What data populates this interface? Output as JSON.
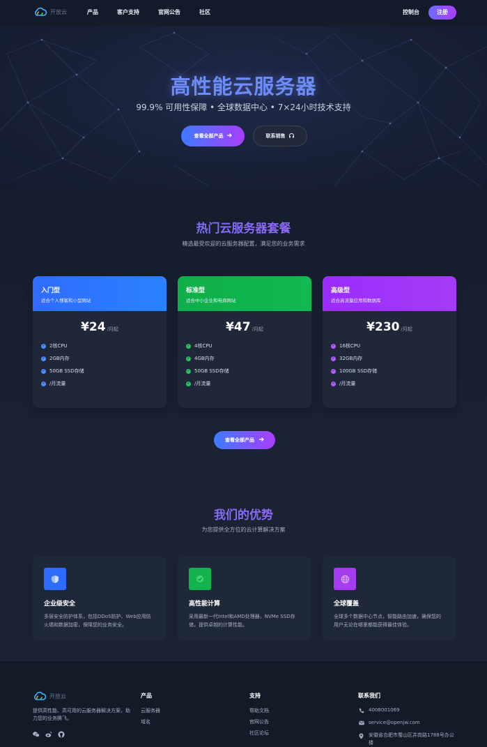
{
  "nav": {
    "logo_text": "开放云",
    "links": [
      "产品",
      "客户支持",
      "官网公告",
      "社区"
    ],
    "console": "控制台",
    "register": "注册"
  },
  "hero": {
    "title": "高性能云服务器",
    "subtitle": "99.9% 可用性保障 • 全球数据中心 • 7×24小时技术支持",
    "primary_button": "查看全部产品",
    "secondary_button": "联系销售"
  },
  "plans_section": {
    "title": "热门云服务器套餐",
    "subtitle": "精选最受欢迎的云服务器配置，满足您的业务需求",
    "plans": [
      {
        "name": "入门型",
        "desc": "适合个人博客和小型网站",
        "price": "¥24",
        "unit": "/月起",
        "color": "#2f6bff",
        "features": [
          "2核CPU",
          "2GB内存",
          "50GB SSD存储",
          "/月流量"
        ]
      },
      {
        "name": "标准型",
        "desc": "适合中小企业和电商网站",
        "price": "¥47",
        "unit": "/月起",
        "color": "#0fae4a",
        "features": [
          "4核CPU",
          "4GB内存",
          "50GB SSD存储",
          "/月流量"
        ]
      },
      {
        "name": "高级型",
        "desc": "适合高流量应用和数据库",
        "price": "¥230",
        "unit": "/月起",
        "color": "#9a2cff",
        "features": [
          "16核CPU",
          "32GB内存",
          "100GB SSD存储",
          "/月流量"
        ]
      }
    ],
    "view_all_button": "查看全部产品"
  },
  "advantages_section": {
    "title": "我们的优势",
    "subtitle": "为您提供全方位的云计算解决方案",
    "items": [
      {
        "icon": "shield-icon",
        "color": "#2f6bff",
        "title": "企业级安全",
        "desc": "多层安全防护体系，包括DDoS防护、Web应用防火墙和数据加密，保障您的业务安全。"
      },
      {
        "icon": "chip-icon",
        "color": "#13b34e",
        "title": "高性能计算",
        "desc": "采用最新一代Intel和AMD处理器，NVMe SSD存储，提供卓越的计算性能。"
      },
      {
        "icon": "globe-icon",
        "color": "#a53cf0",
        "title": "全球覆盖",
        "desc": "全球多个数据中心节点，智能路由加速，确保您的用户无论在哪里都能获得最佳体验。"
      }
    ]
  },
  "footer": {
    "logo_text": "开放云",
    "brand_desc": "提供高性能、高可用的云服务器解决方案，助力您的业务腾飞。",
    "products_title": "产品",
    "products": [
      "云服务器",
      "域名"
    ],
    "support_title": "支持",
    "support": [
      "帮助文档",
      "官网公告",
      "社区论坛"
    ],
    "contact_title": "联系我们",
    "phone": "4008001069",
    "email": "service@openjw.com",
    "address": "安徽省合肥市蜀山区井岗路1788号办公楼"
  }
}
